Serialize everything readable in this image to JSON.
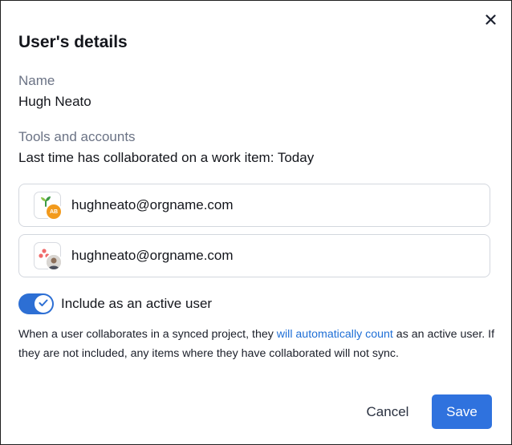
{
  "dialog": {
    "title": "User's details",
    "close_icon": "close-icon"
  },
  "name_section": {
    "label": "Name",
    "value": "Hugh Neato"
  },
  "tools_section": {
    "label": "Tools and accounts",
    "last_collab": "Last time has collaborated on a work item: Today"
  },
  "accounts": [
    {
      "email": "hughneato@orgname.com",
      "tool_icon": "sprout-logo-icon",
      "avatar_initials": "AB",
      "avatar_color": "#f29a1c"
    },
    {
      "email": "hughneato@orgname.com",
      "tool_icon": "asana-logo-icon",
      "avatar_icon": "user-photo-icon"
    }
  ],
  "active_toggle": {
    "label": "Include as an active user",
    "checked": true,
    "on_color": "#2d6fd4"
  },
  "note": {
    "part1": "When a user collaborates in a synced project, they ",
    "link": "will automatically count",
    "part2": " as an active user. If they are not included, any items where they have collaborated will not sync."
  },
  "buttons": {
    "cancel": "Cancel",
    "save": "Save",
    "primary_color": "#2f72de"
  }
}
